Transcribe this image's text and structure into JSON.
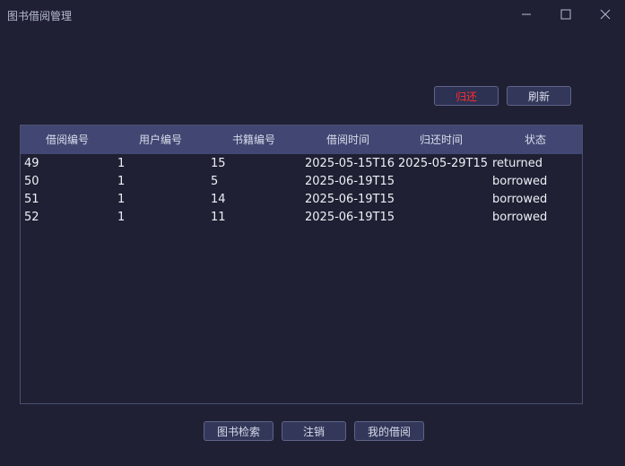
{
  "window": {
    "title": "图书借阅管理"
  },
  "actions": {
    "return_label": "归还",
    "refresh_label": "刷新"
  },
  "table": {
    "columns": [
      "借阅编号",
      "用户编号",
      "书籍编号",
      "借阅时间",
      "归还时间",
      "状态"
    ],
    "rows": [
      [
        "49",
        "1",
        "15",
        "2025-05-15T16...",
        "2025-05-29T15...",
        "returned"
      ],
      [
        "50",
        "1",
        "5",
        "2025-06-19T15...",
        "",
        "borrowed"
      ],
      [
        "51",
        "1",
        "14",
        "2025-06-19T15...",
        "",
        "borrowed"
      ],
      [
        "52",
        "1",
        "11",
        "2025-06-19T15...",
        "",
        "borrowed"
      ]
    ]
  },
  "footer": {
    "search_label": "图书检索",
    "logout_label": "注销",
    "my_borrow_label": "我的借阅"
  },
  "colors": {
    "background": "#1f2033",
    "header": "#414772",
    "return_text": "#ff2d2d"
  }
}
